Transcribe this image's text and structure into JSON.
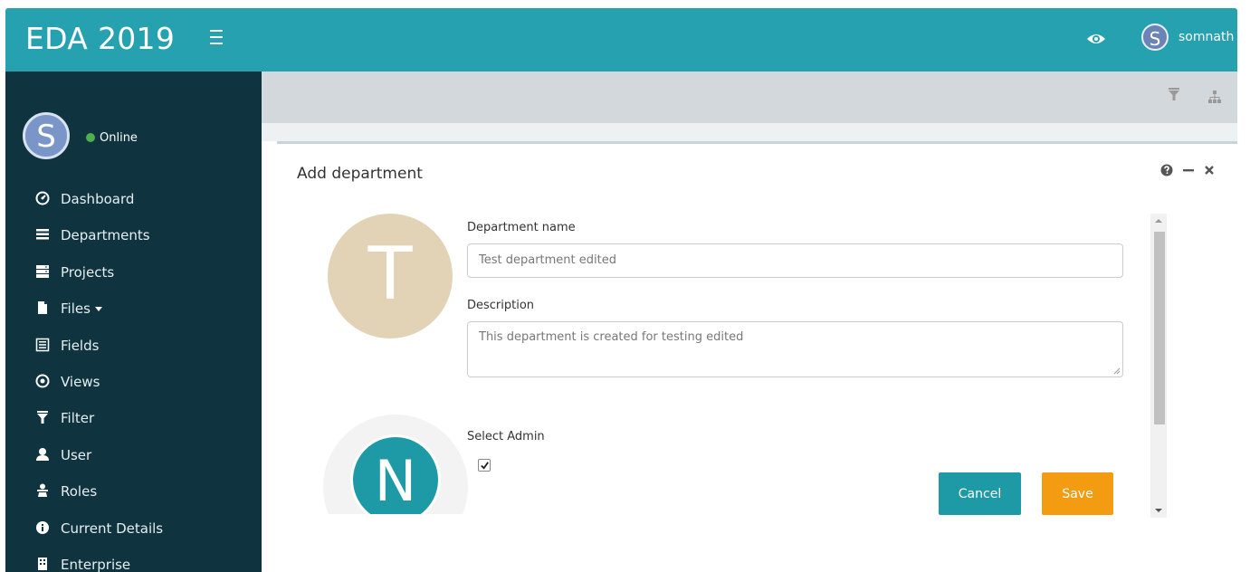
{
  "header": {
    "brand": "EDA 2019",
    "user_initial": "S",
    "user_name": "somnath"
  },
  "sidebar": {
    "avatar_initial": "S",
    "status": "Online",
    "items": [
      {
        "label": "Dashboard",
        "icon": "dashboard-icon"
      },
      {
        "label": "Departments",
        "icon": "list-icon"
      },
      {
        "label": "Projects",
        "icon": "server-icon"
      },
      {
        "label": "Files",
        "icon": "file-icon",
        "has_caret": true
      },
      {
        "label": "Fields",
        "icon": "list-alt-icon"
      },
      {
        "label": "Views",
        "icon": "target-icon"
      },
      {
        "label": "Filter",
        "icon": "filter-icon"
      },
      {
        "label": "User",
        "icon": "user-icon"
      },
      {
        "label": "Roles",
        "icon": "roles-icon"
      },
      {
        "label": "Current Details",
        "icon": "info-icon"
      },
      {
        "label": "Enterprise",
        "icon": "building-icon"
      }
    ]
  },
  "panel": {
    "title": "Add department",
    "avatar_initial": "T",
    "dept_name_label": "Department name",
    "dept_name_value": "Test department edited",
    "description_label": "Description",
    "description_value": "This department is created for testing edited",
    "select_admin_label": "Select Admin",
    "admin_avatar_initial": "N",
    "admin_checked": true,
    "cancel_label": "Cancel",
    "save_label": "Save"
  },
  "colors": {
    "header": "#26a1b0",
    "sidebar": "#0f3440",
    "save": "#f39c12",
    "cancel": "#1d9aa6"
  }
}
